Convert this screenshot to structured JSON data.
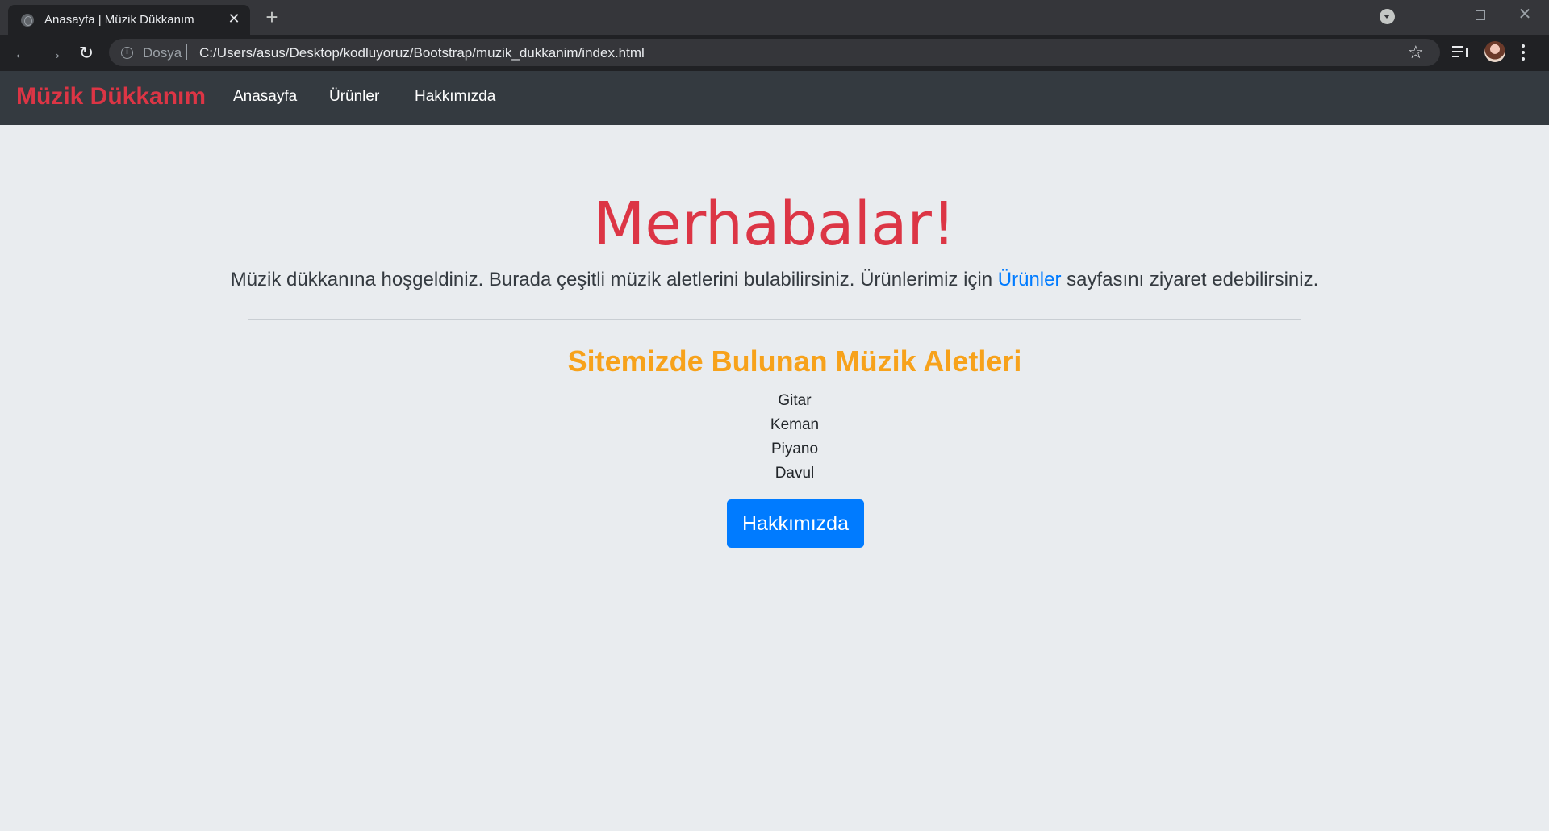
{
  "browser": {
    "tab_title": "Anasayfa | Müzik Dükkanım",
    "omnibox_scheme": "Dosya",
    "url": "C:/Users/asus/Desktop/kodluyoruz/Bootstrap/muzik_dukkanim/index.html"
  },
  "navbar": {
    "brand": "Müzik Dükkanım",
    "links": [
      "Anasayfa",
      "Ürünler",
      "Hakkımızda"
    ]
  },
  "hero": {
    "title": "Merhabalar!",
    "lead_before": "Müzik dükkanına hoşgeldiniz. Burada çeşitli müzik aletlerini bulabilirsiniz. Ürünlerimiz için ",
    "lead_link": "Ürünler",
    "lead_after": " sayfasını ziyaret edebilirsiniz."
  },
  "section": {
    "title": "Sitemizde Bulunan Müzik Aletleri",
    "items": [
      "Gitar",
      "Keman",
      "Piyano",
      "Davul"
    ],
    "button": "Hakkımızda"
  },
  "colors": {
    "brand": "#dc3545",
    "accent": "#f7a21b",
    "link": "#007bff",
    "navbar_bg": "#343a40",
    "page_bg": "#e9ecef"
  },
  "icons": [
    "globe-icon",
    "close-icon",
    "plus-icon",
    "tab-search-icon",
    "back-icon",
    "forward-icon",
    "reload-icon",
    "info-icon",
    "star-icon",
    "media-control-icon",
    "profile-avatar",
    "kebab-menu-icon"
  ]
}
